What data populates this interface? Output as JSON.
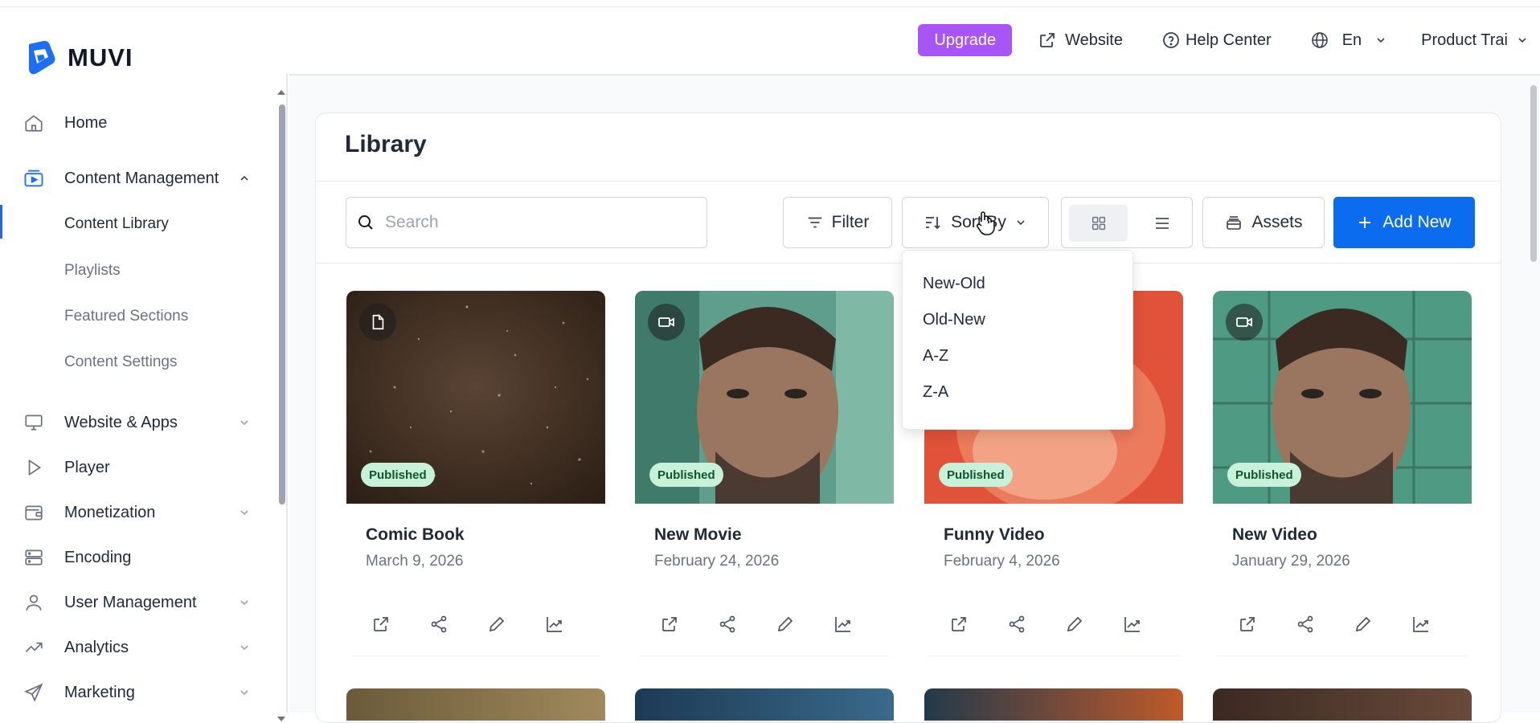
{
  "header": {
    "logo_text": "MUVI",
    "upgrade_label": "Upgrade",
    "website_label": "Website",
    "help_label": "Help Center",
    "language_label": "En",
    "user_label": "Product Trai"
  },
  "sidebar": {
    "items": [
      {
        "label": "Home",
        "icon": "home-icon"
      },
      {
        "label": "Content Management",
        "icon": "content-management-icon",
        "expanded": true
      },
      {
        "label": "Website & Apps",
        "icon": "monitor-icon"
      },
      {
        "label": "Player",
        "icon": "play-icon"
      },
      {
        "label": "Monetization",
        "icon": "wallet-icon"
      },
      {
        "label": "Encoding",
        "icon": "server-icon"
      },
      {
        "label": "User Management",
        "icon": "user-icon"
      },
      {
        "label": "Analytics",
        "icon": "trend-icon"
      },
      {
        "label": "Marketing",
        "icon": "send-icon"
      }
    ],
    "sub_items": [
      {
        "label": "Content Library",
        "active": true
      },
      {
        "label": "Playlists"
      },
      {
        "label": "Featured Sections"
      },
      {
        "label": "Content Settings"
      }
    ]
  },
  "library": {
    "title": "Library",
    "search_placeholder": "Search",
    "filter_label": "Filter",
    "sort_label": "Sort By",
    "assets_label": "Assets",
    "add_label": "Add New",
    "sort_options": [
      "New-Old",
      "Old-New",
      "A-Z",
      "Z-A"
    ],
    "items": [
      {
        "title": "Comic Book",
        "date": "March 9, 2026",
        "status": "Published",
        "type_icon": "document-icon"
      },
      {
        "title": "New Movie",
        "date": "February 24, 2026",
        "status": "Published",
        "type_icon": "video-icon"
      },
      {
        "title": "Funny Video",
        "date": "February 4, 2026",
        "status": "Published",
        "type_icon": "video-icon"
      },
      {
        "title": "New Video",
        "date": "January 29, 2026",
        "status": "Published",
        "type_icon": "video-icon"
      }
    ]
  },
  "colors": {
    "accent_blue": "#0b6cf0",
    "upgrade_purple": "#a855f7",
    "badge_green": "#c7f1d9"
  }
}
